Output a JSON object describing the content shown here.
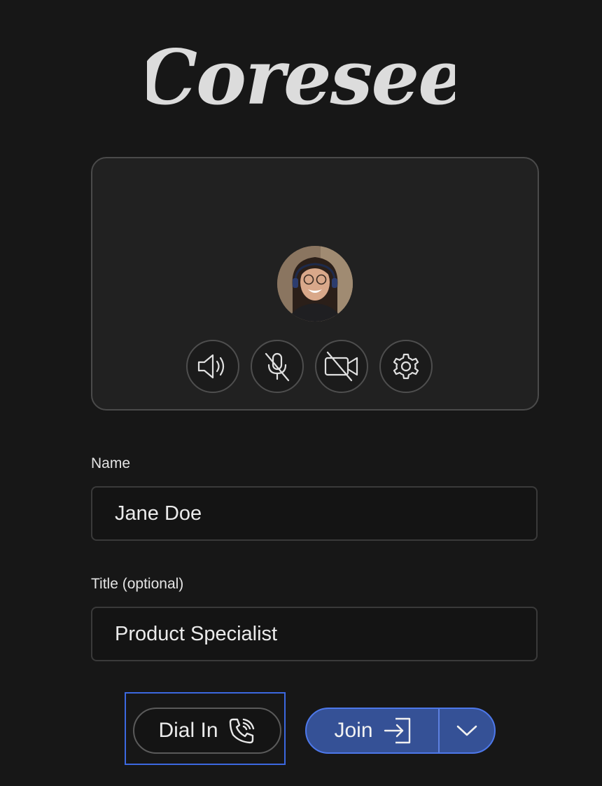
{
  "app": {
    "logo_text": "Coresee"
  },
  "preview": {
    "avatar_alt": "User avatar",
    "controls": [
      {
        "name": "speaker",
        "icon": "speaker-icon"
      },
      {
        "name": "microphone",
        "icon": "microphone-muted-icon"
      },
      {
        "name": "camera",
        "icon": "camera-off-icon"
      },
      {
        "name": "settings",
        "icon": "gear-icon"
      }
    ]
  },
  "form": {
    "name_label": "Name",
    "name_value": "Jane Doe",
    "title_label": "Title (optional)",
    "title_value": "Product Specialist"
  },
  "actions": {
    "dial_in_label": "Dial In",
    "dial_in_icon": "phone-ringing-icon",
    "join_label": "Join",
    "join_icon": "enter-icon",
    "join_menu_icon": "chevron-down-icon"
  },
  "colors": {
    "background": "#171717",
    "accent": "#355196",
    "focus": "#3c68e0"
  }
}
